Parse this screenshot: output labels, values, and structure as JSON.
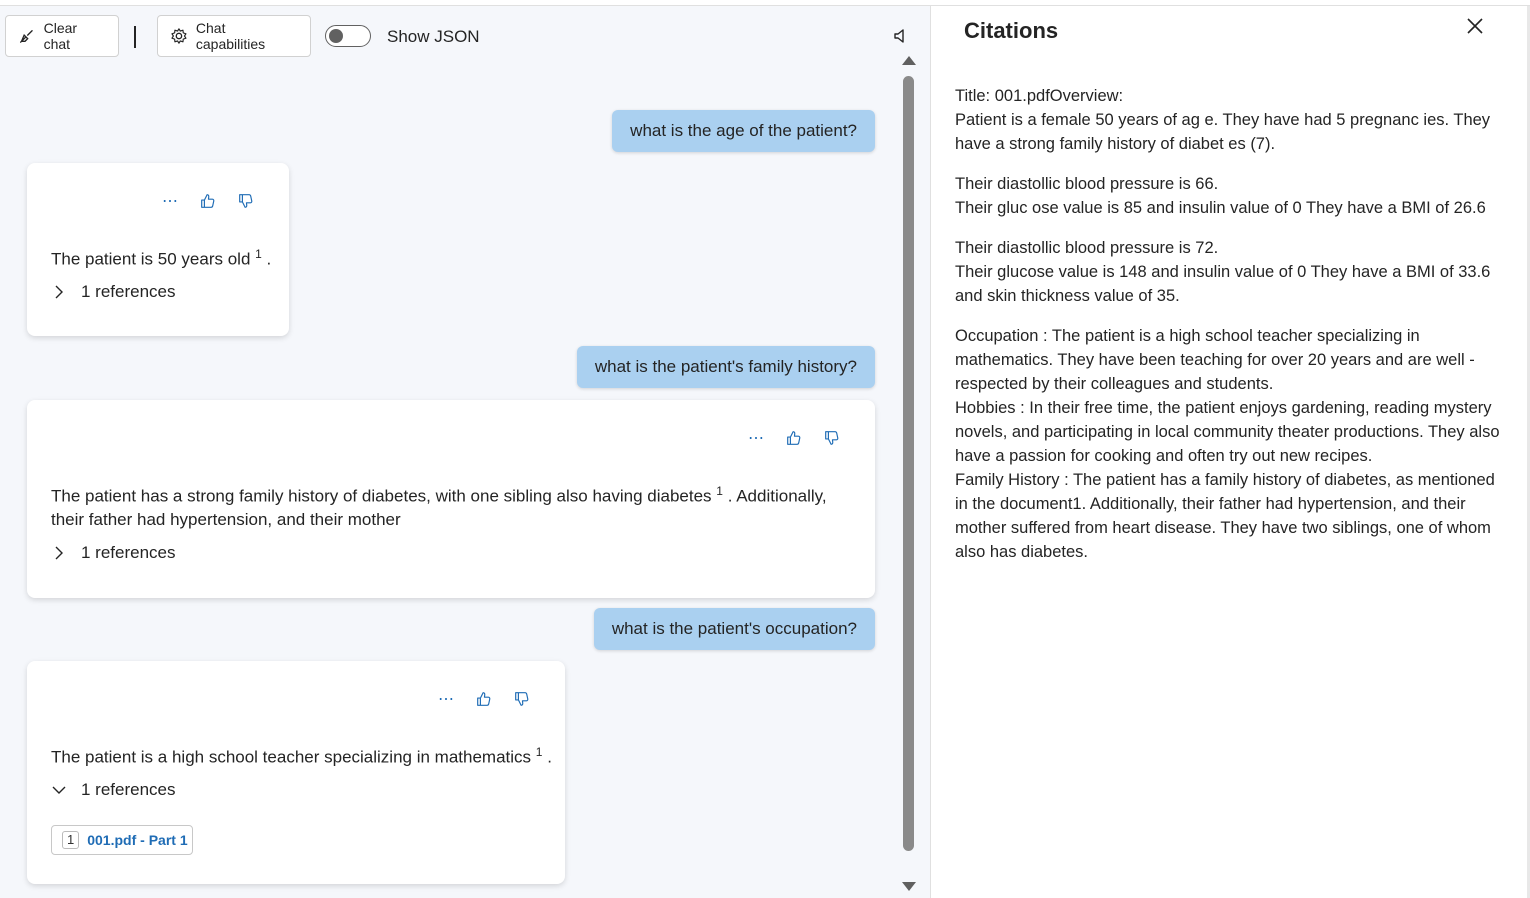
{
  "toolbar": {
    "clear_label": "Clear chat",
    "capabilities_label": "Chat capabilities",
    "toggle_label": "Show JSON"
  },
  "messages": [
    {
      "role": "user",
      "text": "what is the age of the patient?"
    },
    {
      "role": "assistant",
      "text": "The patient is 50 years old",
      "sup": "1",
      "tail": " .",
      "refs_label": "1 references"
    },
    {
      "role": "user",
      "text": "what is the patient's family history?"
    },
    {
      "role": "assistant",
      "text": "The patient has a strong family history of diabetes, with one sibling also having diabetes",
      "sup": "1",
      "tail": " . Additionally, their father had hypertension, and their mother",
      "refs_label": "1 references"
    },
    {
      "role": "user",
      "text": "what is the patient's occupation?"
    },
    {
      "role": "assistant",
      "text": "The patient is a high school teacher specializing in mathematics",
      "sup": "1",
      "tail": " .",
      "refs_label": "1 references",
      "ref_num": "1",
      "ref_title": "001.pdf - Part 1"
    }
  ],
  "citations": {
    "title": "Citations",
    "p1_l1": "Title: 001.pdfOverview:",
    "p1_l2": "Patient is a female 50 years of ag e. They have had 5 pregnanc ies. They have a strong family history of diabet es (7).",
    "p2_l1": "Their diastollic blood pressure is 66.",
    "p2_l2": "Their gluc ose value is 85 and insulin value of 0 They have a BMI of 26.6",
    "p3_l1": "Their diastollic blood pressure is 72.",
    "p3_l2": "Their glucose value is 148 and insulin value of 0 They have a BMI of 33.6 and skin thickness value of 35.",
    "p4_l1": "Occupation : The patient is a high school teacher specializing in mathematics. They have been teaching for over 20 years and are well - respected by their colleagues and students.",
    "p4_l2": "Hobbies : In their free time, the patient enjoys gardening, reading mystery novels, and participating in local community theater productions. They also have a passion for cooking and often try out new recipes.",
    "p4_l3": "Family History : The patient has a family history of diabetes, as mentioned in the document1. Additionally, their father had hypertension, and their mother suffered from heart disease. They have two siblings, one of whom also has diabetes."
  },
  "colors": {
    "accent": "#1f6cb5",
    "user_bubble": "#aad0f0"
  }
}
